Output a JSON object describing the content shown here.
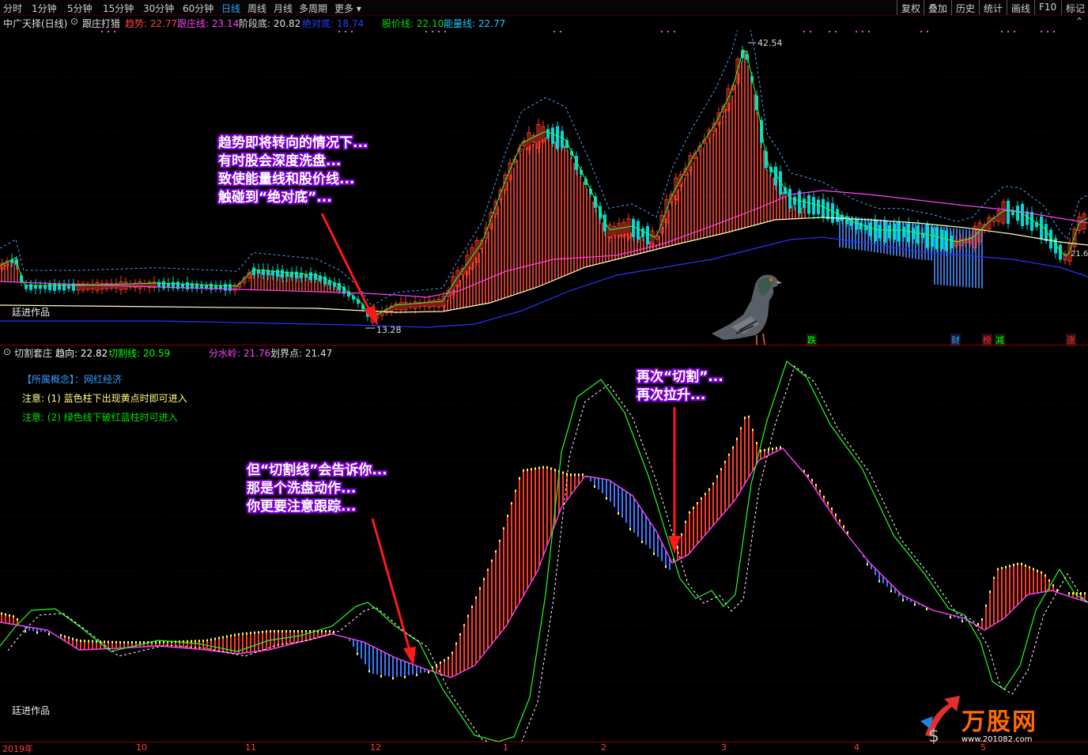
{
  "toolbar": {
    "periods": [
      "分时",
      "1分钟",
      "5分钟",
      "15分钟",
      "30分钟",
      "60分钟",
      "日线",
      "周线",
      "月线",
      "多周期",
      "更多"
    ],
    "active_period": "日线",
    "actions": [
      "复权",
      "叠加",
      "历史",
      "统计",
      "画线",
      "F10",
      "标记"
    ]
  },
  "main_panel": {
    "stock": "中广天择(日线)",
    "indicator": "跟庄打猎",
    "trend_label": "趋势: 22.77",
    "zhuangxian_label": "跟庄线: 23.14",
    "stage_bottom_label": "阶段底: 20.82",
    "absolute_bottom_label": "绝对底: 18.74",
    "price_line_label": "股价线: 22.10",
    "energy_line_label": "能量线: 22.77",
    "high_marker": "42.54",
    "low_marker": "13.28",
    "right_marker": "21.6",
    "watermark": "廷进作品",
    "signals": [
      "跌",
      "财",
      "榜",
      "减",
      "涨"
    ]
  },
  "sub_panel": {
    "indicator": "切割套庄",
    "qushi_label": "趋向: 22.82",
    "cut_line_label": "切割线: 20.59",
    "watershed_label": "分水岭: 21.76",
    "boundary_label": "划界点: 21.47",
    "concept_label": "【所属概念】：",
    "concept_value": "网红经济",
    "note1": "注意: (1) 蓝色柱下出现黄点时即可进入",
    "note2": "注意: (2) 绿色线下破红蓝柱时可进入",
    "watermark": "廷进作品"
  },
  "annotations": {
    "a1": [
      "趋势即将转向的情况下...",
      "有时股会深度洗盘...",
      "致使能量线和股价线...",
      "触碰到“绝对底”..."
    ],
    "a2": [
      "但“切割线”会告诉你...",
      "那是个洗盘动作...",
      "你更要注意跟踪..."
    ],
    "a3": [
      "再次“切割”...",
      "再次拉升..."
    ]
  },
  "x_axis": {
    "labels": [
      "2019年",
      "10",
      "11",
      "12",
      "1",
      "2",
      "3",
      "4",
      "5"
    ]
  },
  "logo": {
    "text": "万股网",
    "url": "www.201082.com"
  },
  "colors": {
    "up": "#ff3a2a",
    "down": "#00d8d8",
    "bar_up": "#ff3a2a",
    "bar_down": "#3a7aff",
    "cut_line": "#00ff00",
    "energy": "#ff40ff",
    "boundary": "#ffffff"
  },
  "chart_data": [
    {
      "type": "line",
      "title": "跟庄打猎",
      "x": [
        "2019-09",
        "2019-10",
        "2019-11",
        "2019-12",
        "2020-01",
        "2020-02",
        "2020-03",
        "2020-04",
        "2020-05"
      ],
      "series": [
        {
          "name": "趋势",
          "values": [
            16.5,
            16.3,
            16.6,
            14.0,
            24.0,
            22.5,
            35.0,
            22.0,
            21.6
          ]
        },
        {
          "name": "股价线",
          "values": [
            16.4,
            16.2,
            16.5,
            14.2,
            23.0,
            22.0,
            33.0,
            21.5,
            22.1
          ]
        },
        {
          "name": "能量线",
          "values": [
            16.6,
            16.5,
            16.8,
            15.5,
            19.5,
            21.0,
            25.0,
            24.0,
            22.77
          ]
        }
      ],
      "annotations": {
        "high": 42.54,
        "low": 13.28
      }
    },
    {
      "type": "bar",
      "title": "切割套庄",
      "series": [
        {
          "name": "切割线",
          "values": [
            0.2,
            0.5,
            0.3,
            -0.8,
            1.2,
            0.9,
            1.8,
            0.2,
            -0.3
          ]
        },
        {
          "name": "分水岭",
          "values": [
            0.1,
            0.2,
            0.2,
            -0.6,
            0.6,
            1.1,
            1.3,
            0.5,
            -0.1
          ]
        }
      ]
    }
  ]
}
